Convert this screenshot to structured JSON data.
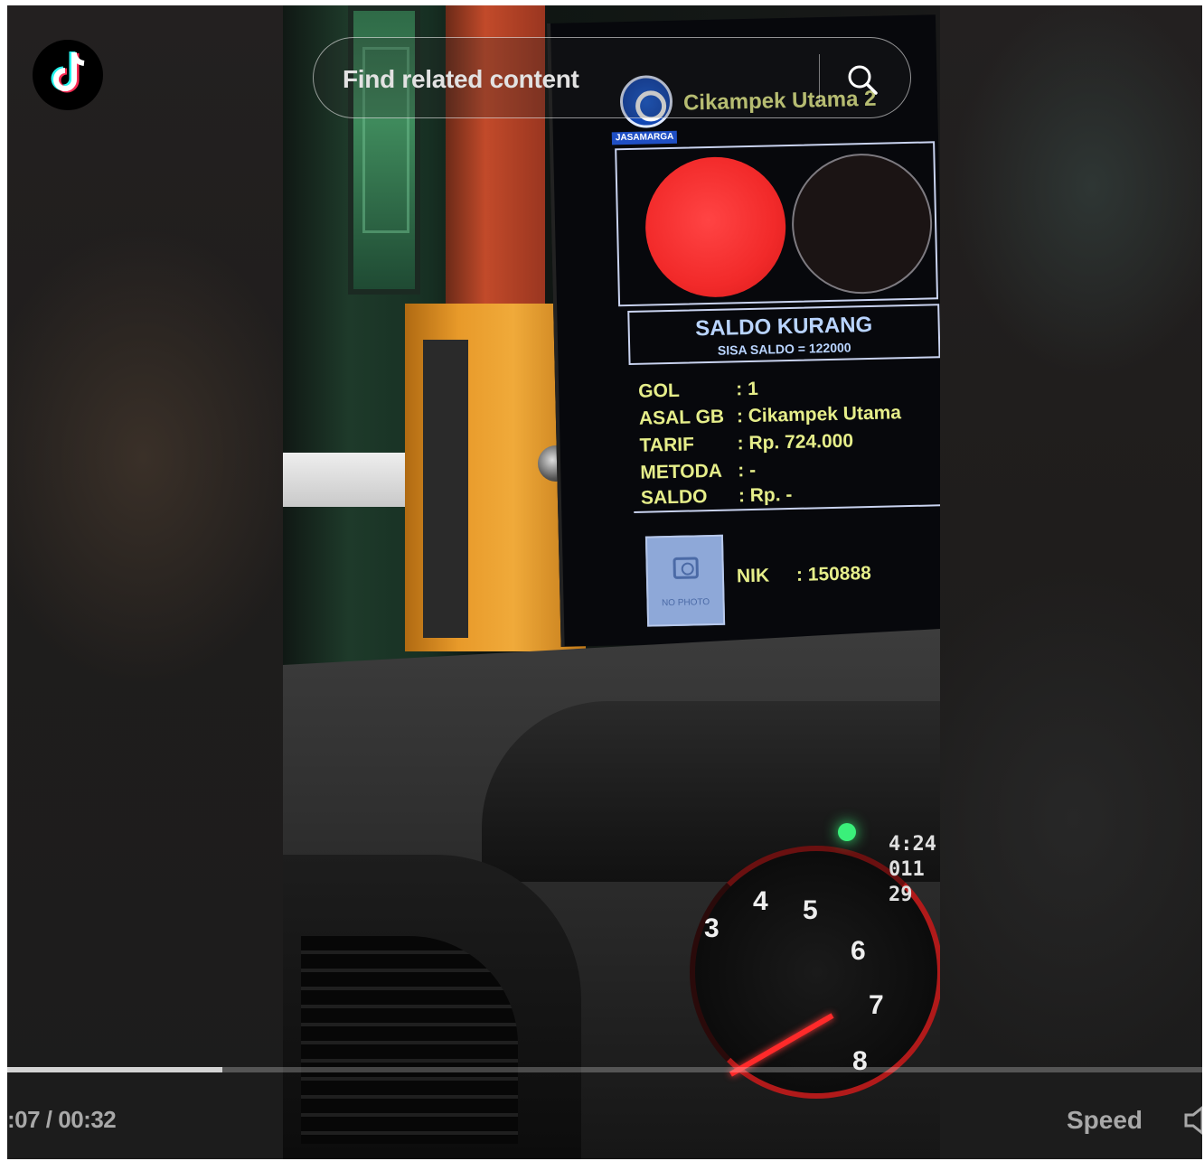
{
  "search": {
    "placeholder": "Find related content"
  },
  "toll_display": {
    "operator_label": "JASAMARGA",
    "gate_name": "Cikampek Utama 2",
    "status_title": "SALDO KURANG",
    "status_sub": "SISA SALDO = 122000",
    "rows": [
      {
        "key": "GOL",
        "value": ": 1"
      },
      {
        "key": "ASAL GB",
        "value": ": Cikampek Utama"
      },
      {
        "key": "TARIF",
        "value": ": Rp. 724.000"
      },
      {
        "key": "METODA",
        "value": ": -"
      },
      {
        "key": "SALDO",
        "value": ": Rp. -"
      }
    ],
    "photo_placeholder": "NO PHOTO",
    "nik_label": "NIK",
    "nik_value": ": 150888"
  },
  "dashboard": {
    "gauge_numbers": [
      "3",
      "4",
      "5",
      "6",
      "7",
      "8"
    ],
    "cluster_lines": [
      "4:24",
      "011",
      "29"
    ]
  },
  "player": {
    "time": ":07 / 00:32",
    "progress": 0.18,
    "speed_label": "Speed"
  },
  "colors": {
    "tiktok_cyan": "#25f4ee",
    "tiktok_red": "#fe2c55",
    "toll_text_yellow": "#e6ee8a",
    "toll_text_blue": "#b9d4ff",
    "stop_light_red": "#f22a2a"
  },
  "icons": {
    "logo": "tiktok-logo-icon",
    "search": "search-icon",
    "volume": "volume-icon"
  }
}
